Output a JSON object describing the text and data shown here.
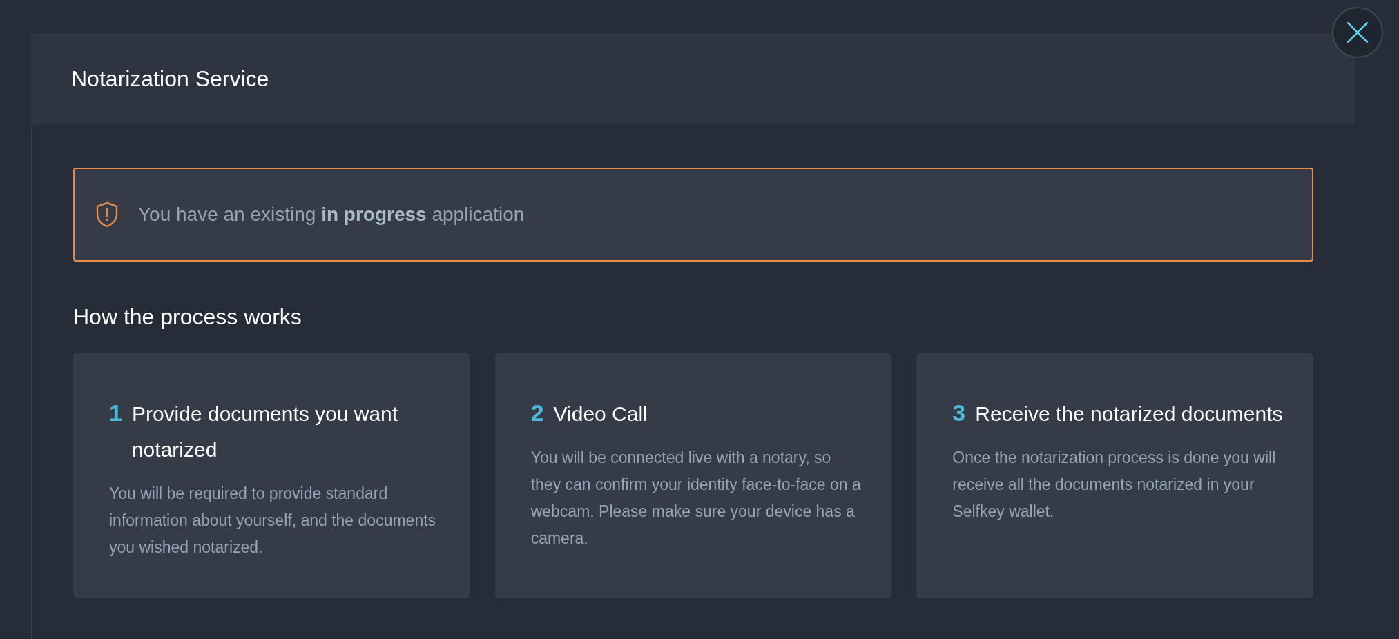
{
  "header": {
    "title": "Notarization Service"
  },
  "alert": {
    "text": "You have an existing **in progress** application"
  },
  "section_title": "How the process works",
  "steps": [
    {
      "number": "1",
      "title": "Provide documents you want notarized",
      "text": "You will be required to provide standard information about yourself, and the documents you wished notarized."
    },
    {
      "number": "2",
      "title": "Video Call",
      "text": "You will be connected live with a notary, so they can confirm your identity face-to-face on a webcam. Please make sure your device has a camera."
    },
    {
      "number": "3",
      "title": "Receive the notarized documents",
      "text": "Once the notarization process is done you will receive all the documents notarized in your Selfkey wallet."
    }
  ]
}
